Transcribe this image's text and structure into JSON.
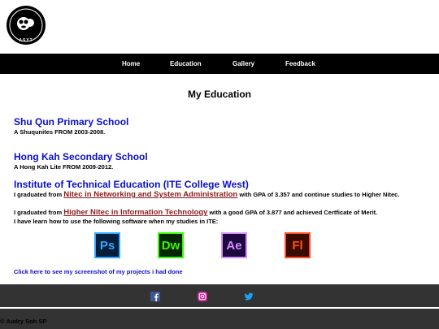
{
  "brand": {
    "logo_text": "ASYT"
  },
  "nav": {
    "items": [
      {
        "label": "Home"
      },
      {
        "label": "Education"
      },
      {
        "label": "Gallery"
      },
      {
        "label": "Feedback"
      }
    ]
  },
  "main": {
    "title": "My Education",
    "schools": [
      {
        "name": "Shu Qun Primary School",
        "desc": "A Shuqunites FROM 2003-2008."
      },
      {
        "name": "Hong Kah Secondary School",
        "desc": "A Hong Kah Lite FROM 2009-2012."
      },
      {
        "name": "Institute of Technical Education (ITE College West)",
        "line1_pre": "I graduated from ",
        "line1_link": "Nitec in Networking and System Administration",
        "line1_post": " with GPA of 3.357 and continue studies to Higher Nitec.",
        "line2_pre": "I graduated from ",
        "line2_link": "Higher Nitec in Information Technology",
        "line2_post": " with a good GPA of 3.877 and achieved Certficate of Merit.",
        "line3": "I have learn how to use the following software when my studies in ITE:"
      }
    ],
    "software": [
      {
        "name": "photoshop-icon",
        "abbr": "Ps",
        "bg": "#061e3a",
        "fg": "#31a8ff"
      },
      {
        "name": "dreamweaver-icon",
        "abbr": "Dw",
        "bg": "#072401",
        "fg": "#35fa00"
      },
      {
        "name": "after-effects-icon",
        "abbr": "Ae",
        "bg": "#1f0740",
        "fg": "#d291ff"
      },
      {
        "name": "flash-icon",
        "abbr": "Fl",
        "bg": "#3a0b00",
        "fg": "#ff4f1f"
      }
    ],
    "projects_link": "Click here to see my screenshot of my projects i had done"
  },
  "footer": {
    "copyright": "© Audry Soh SP"
  },
  "colors": {
    "nav_bg": "#000000",
    "footer_bg": "#333333",
    "heading_blue": "#0a10c8",
    "link_red": "#8b1a1a"
  }
}
